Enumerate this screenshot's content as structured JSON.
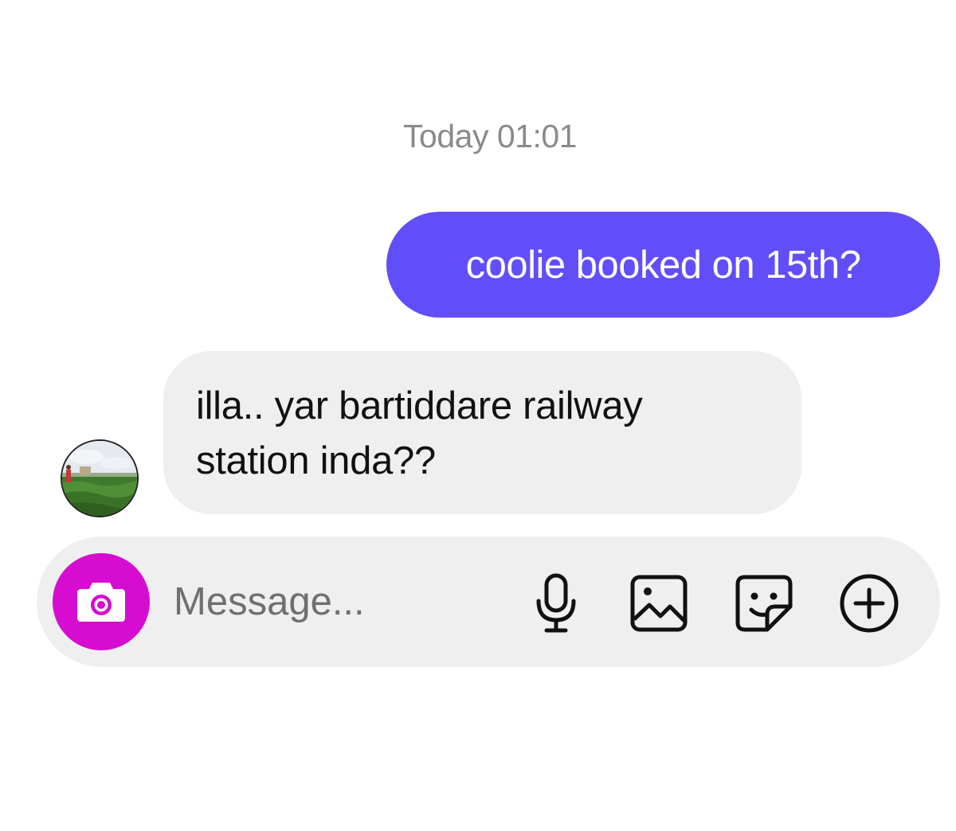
{
  "chat": {
    "timestamp": "Today 01:01",
    "messages": [
      {
        "direction": "sent",
        "text": "coolie booked on 15th?"
      },
      {
        "direction": "received",
        "text_line1": "illa.. yar bartiddare railway",
        "text_line2": "station inda??"
      }
    ]
  },
  "composer": {
    "placeholder": "Message...",
    "buttons": [
      "camera-icon",
      "microphone-icon",
      "gallery-icon",
      "sticker-icon",
      "plus-icon"
    ]
  },
  "colors": {
    "sent_bubble": "#624ef9",
    "received_bubble": "#efefef",
    "camera_button": "#d60dd0",
    "timestamp_text": "#8a8a8a"
  }
}
